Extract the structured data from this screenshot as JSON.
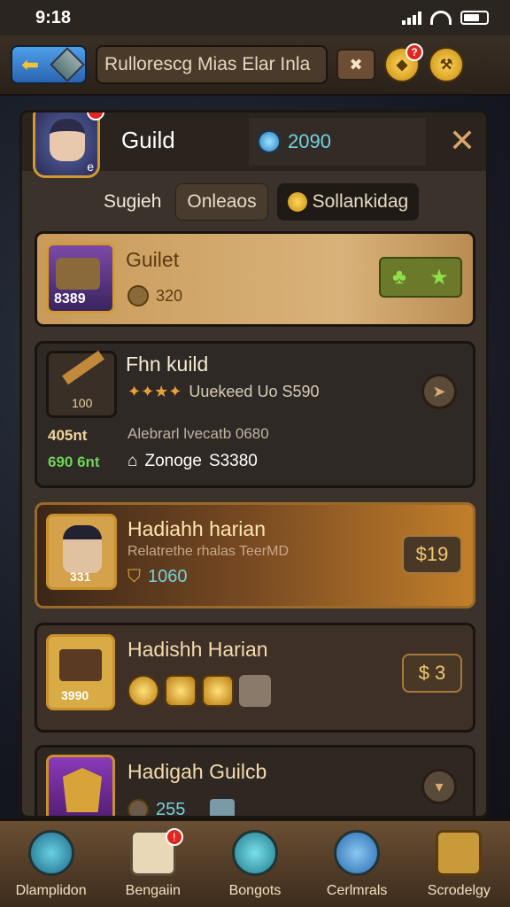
{
  "status": {
    "time": "9:18"
  },
  "topbar": {
    "title": "Rullorescg Mias Elar Inla",
    "notification_count": "?"
  },
  "header": {
    "title": "Guild",
    "currency": "2090",
    "avatar_badge": "e"
  },
  "tabs": [
    {
      "label": "Sugieh"
    },
    {
      "label": "Onleaos"
    },
    {
      "label": "Sollankidag"
    }
  ],
  "cards": [
    {
      "title": "Guilet",
      "thumb_value": "8389",
      "stat": "320"
    },
    {
      "title": "Fhn kuild",
      "thumb_value": "100",
      "desc": "Uuekeed Uo S590",
      "left_a": "405nt",
      "left_b": "690 6nt",
      "sub_line": "Alebrarl lvecatb 0680",
      "zone_label": "Zonoge",
      "zone_value": "S3380"
    },
    {
      "title": "Hadiahh harian",
      "thumb_value": "331",
      "desc": "Relatrethe rhalas TeerMD",
      "gems": "1060",
      "price": "$19"
    },
    {
      "title": "Hadishh Harian",
      "thumb_value": "3990",
      "price": "$ 3"
    },
    {
      "title": "Hadigah Guilcb",
      "stat": "255"
    }
  ],
  "nav": [
    {
      "label": "Dlamplidon",
      "icon": "magnifier-icon"
    },
    {
      "label": "Bengaiin",
      "icon": "ticket-icon",
      "badge": "!"
    },
    {
      "label": "Bongots",
      "icon": "controller-icon"
    },
    {
      "label": "Cerlmrals",
      "icon": "quill-icon"
    },
    {
      "label": "Scrodelgy",
      "icon": "chest-icon"
    }
  ],
  "colors": {
    "accent": "#d19a32",
    "panel": "#3a322b",
    "highlight": "#c18e4c",
    "gem": "#71d3e0"
  }
}
